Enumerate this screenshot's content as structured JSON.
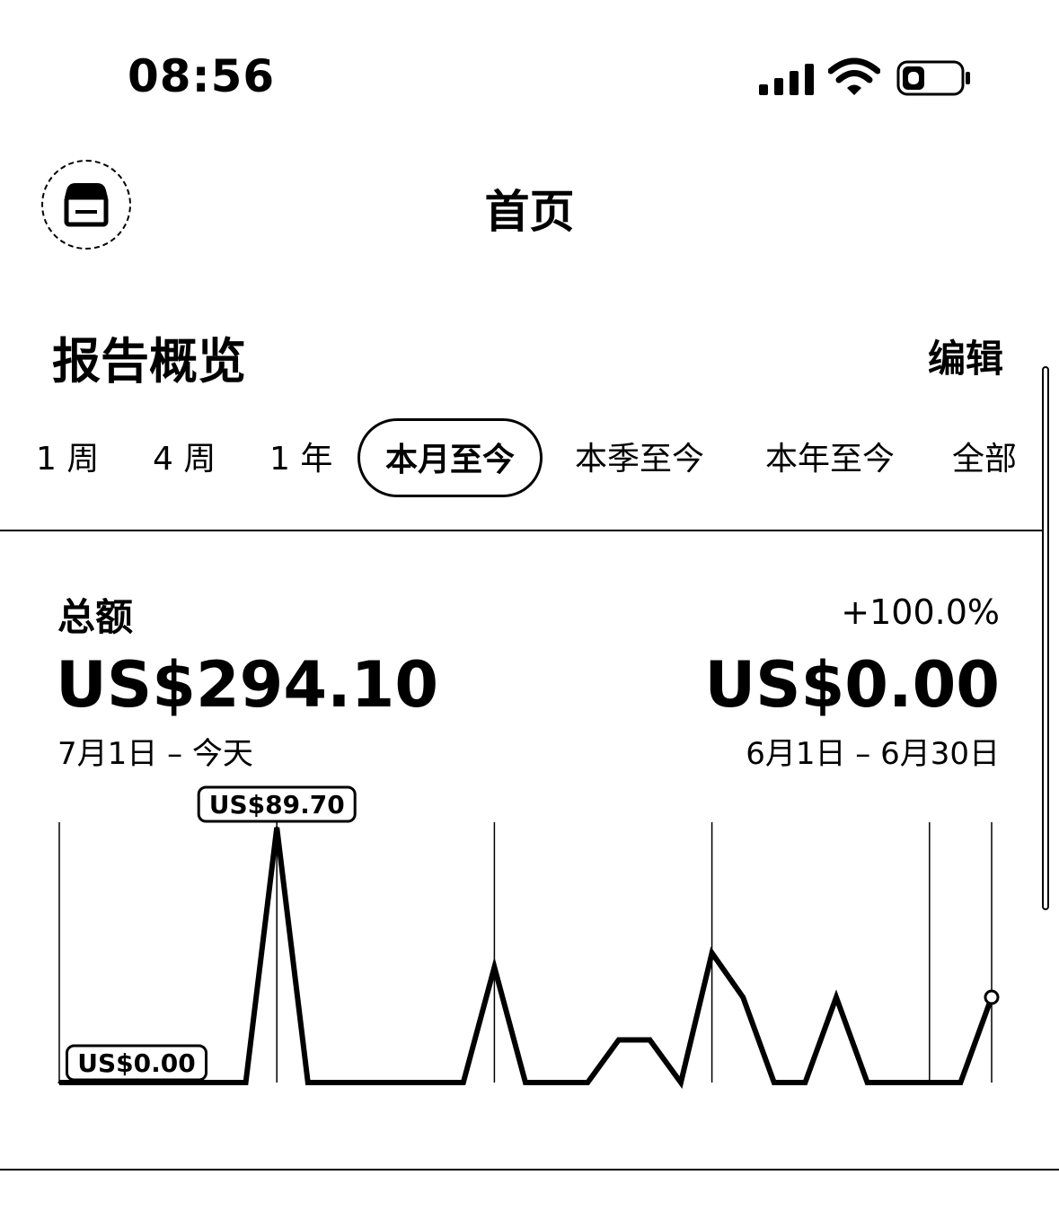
{
  "status_bar": {
    "time": "08:56"
  },
  "nav": {
    "title": "首页",
    "store_icon": "storefront-icon"
  },
  "section": {
    "title": "报告概览",
    "edit_label": "编辑"
  },
  "tabs": [
    {
      "label": "1 周",
      "selected": false
    },
    {
      "label": "4 周",
      "selected": false
    },
    {
      "label": "1 年",
      "selected": false
    },
    {
      "label": "本月至今",
      "selected": true
    },
    {
      "label": "本季至今",
      "selected": false
    },
    {
      "label": "本年至今",
      "selected": false
    },
    {
      "label": "全部",
      "selected": false
    }
  ],
  "summary": {
    "label": "总额",
    "change": "+100.0%",
    "current_amount": "US$294.10",
    "previous_amount": "US$0.00",
    "current_range": "7月1日 – 今天",
    "previous_range": "6月1日 – 6月30日"
  },
  "chart_data": {
    "type": "line",
    "max_label": "US$89.70",
    "min_label": "US$0.00",
    "x": [
      1,
      2,
      3,
      4,
      5,
      6,
      7,
      8,
      9,
      10,
      11,
      12,
      13,
      14,
      15,
      16,
      17,
      18,
      19,
      20,
      21,
      22,
      23,
      24,
      25,
      26,
      27,
      28,
      29,
      30,
      31
    ],
    "values": [
      0,
      0,
      0,
      0,
      0,
      0,
      0,
      89.7,
      0,
      0,
      0,
      0,
      0,
      0,
      40.6,
      0,
      0,
      0,
      15.0,
      15.0,
      0,
      45.6,
      30.0,
      0,
      0,
      30.0,
      0,
      0,
      0,
      0,
      30.0
    ],
    "ylim": [
      0,
      89.7
    ]
  }
}
